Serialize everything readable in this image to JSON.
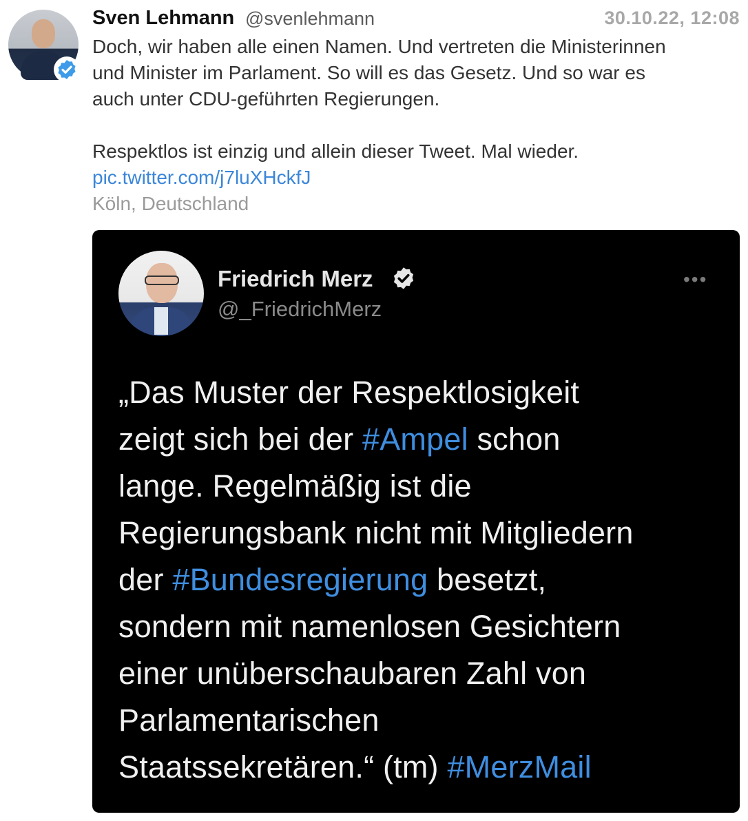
{
  "tweet": {
    "author_name": "Sven Lehmann",
    "author_handle": "@svenlehmann",
    "timestamp": "30.10.22, 12:08",
    "text_line1": "Doch, wir haben alle einen Namen. Und vertreten die Ministerinnen",
    "text_line2": "und Minister im Parlament. So will es das Gesetz. Und so war es",
    "text_line3": "auch unter CDU-geführten Regierungen.",
    "text_para2": "Respektlos ist einzig und allein dieser Tweet. Mal wieder.",
    "link": "pic.twitter.com/j7luXHckfJ",
    "location": "Köln, Deutschland"
  },
  "embedded": {
    "author_name": "Friedrich Merz",
    "author_handle": "@_FriedrichMerz",
    "more_label": "•••",
    "quote": {
      "l1": "„Das Muster der Respektlosigkeit",
      "l2a": "zeigt sich bei der ",
      "l2_tag": "#Ampel",
      "l2b": " schon",
      "l3": "lange. Regelmäßig ist die",
      "l4": "Regierungsbank nicht mit Mitgliedern",
      "l5a": "der ",
      "l5_tag": "#Bundesregierung",
      "l5b": " besetzt,",
      "l6": "sondern mit namenlosen Gesichtern",
      "l7": "einer unüberschaubaren Zahl von",
      "l8": "Parlamentarischen",
      "l9a": "Staatssekretären.“ (tm) ",
      "l9_tag": "#MerzMail"
    }
  },
  "icons": {
    "verified_badge": "verified-check-icon",
    "more": "more-options-icon"
  },
  "colors": {
    "link": "#3b86d9",
    "verified": "#3d9be9",
    "embed_background": "#000000",
    "hashtag": "#3f8ee0"
  }
}
